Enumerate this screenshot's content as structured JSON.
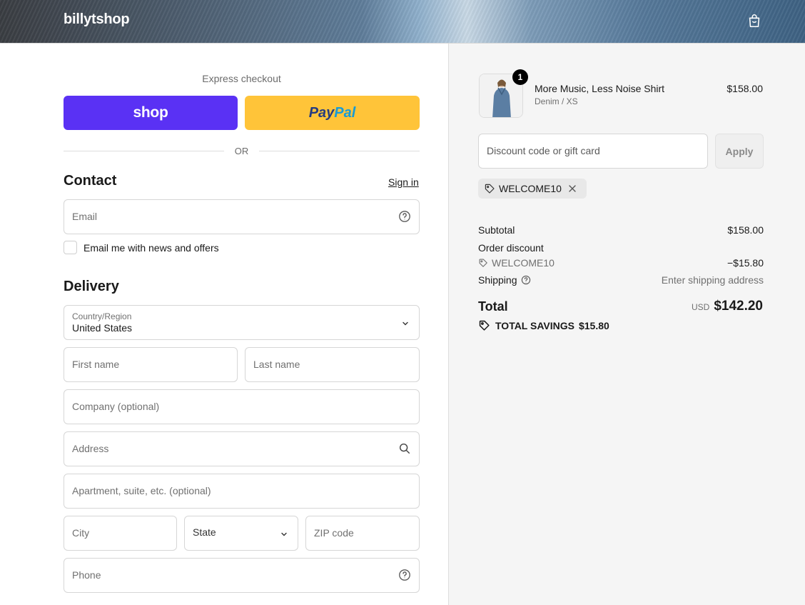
{
  "header": {
    "brand": "billytshop"
  },
  "express": {
    "label": "Express checkout",
    "shop_label": "shop",
    "paypal_pay": "Pay",
    "paypal_pal": "Pal",
    "or_text": "OR"
  },
  "contact": {
    "title": "Contact",
    "signin": "Sign in",
    "email_placeholder": "Email",
    "newsletter_label": "Email me with news and offers"
  },
  "delivery": {
    "title": "Delivery",
    "country_label": "Country/Region",
    "country_value": "United States",
    "first_name": "First name",
    "last_name": "Last name",
    "company": "Company (optional)",
    "address": "Address",
    "apartment": "Apartment, suite, etc. (optional)",
    "city": "City",
    "state": "State",
    "zip": "ZIP code",
    "phone": "Phone"
  },
  "cart": {
    "quantity": "1",
    "product_name": "More Music, Less Noise Shirt",
    "variant": "Denim / XS",
    "price": "$158.00",
    "discount_placeholder": "Discount code or gift card",
    "apply_label": "Apply",
    "applied_code": "WELCOME10",
    "subtotal_label": "Subtotal",
    "subtotal_value": "$158.00",
    "order_discount_label": "Order discount",
    "discount_code": "WELCOME10",
    "discount_value": "−$15.80",
    "shipping_label": "Shipping",
    "shipping_value": "Enter shipping address",
    "total_label": "Total",
    "currency": "USD",
    "total_value": "$142.20",
    "savings_label": "TOTAL SAVINGS",
    "savings_value": "$15.80"
  },
  "colors": {
    "shop_pay": "#5a31f4",
    "paypal": "#ffc439",
    "summary_bg": "#f5f5f5"
  },
  "icons": [
    "shopping-bag-icon",
    "help-circle-icon",
    "chevron-down-icon",
    "search-icon",
    "tag-icon",
    "close-icon"
  ]
}
